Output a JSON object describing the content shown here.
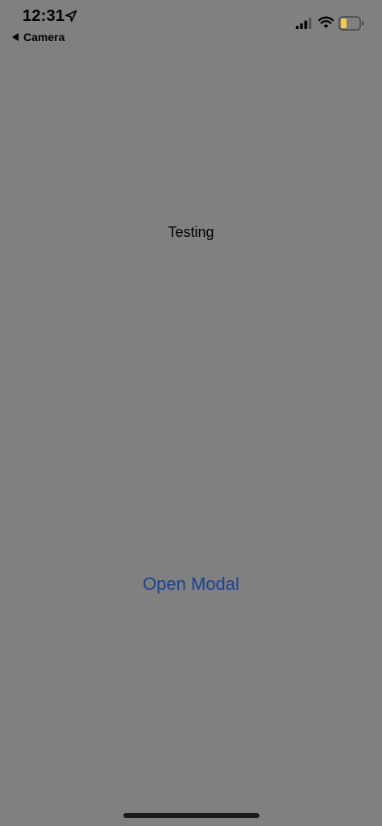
{
  "status_bar": {
    "time": "12:31",
    "back_label": "Camera",
    "icons": [
      "location-arrow-icon",
      "cellular-signal-icon",
      "wifi-icon",
      "battery-icon"
    ],
    "battery_color": "#f2c94c"
  },
  "main": {
    "label": "Testing",
    "button_label": "Open Modal",
    "button_color": "#1a4294",
    "background_color": "#808080"
  }
}
